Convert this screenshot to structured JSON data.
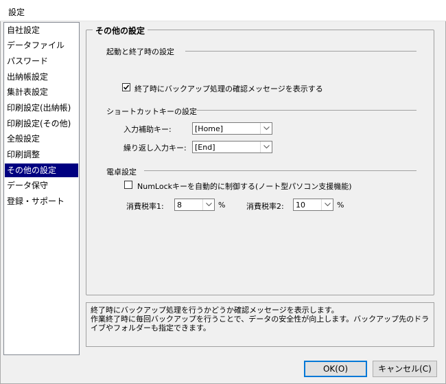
{
  "window": {
    "title": "設定"
  },
  "sidebar": {
    "items": [
      {
        "label": "自社設定"
      },
      {
        "label": "データファイル"
      },
      {
        "label": "パスワード"
      },
      {
        "label": "出納帳設定"
      },
      {
        "label": "集計表設定"
      },
      {
        "label": "印刷設定(出納帳)"
      },
      {
        "label": "印刷設定(その他)"
      },
      {
        "label": "全般設定"
      },
      {
        "label": "印刷調整"
      },
      {
        "label": "その他の設定"
      },
      {
        "label": "データ保守"
      },
      {
        "label": "登録・サポート"
      }
    ],
    "selected_label": "その他の設定"
  },
  "panel": {
    "title": "その他の設定",
    "startup": {
      "heading": "起動と終了時の設定",
      "backup_check_label": "終了時にバックアップ処理の確認メッセージを表示する",
      "backup_checked": true
    },
    "shortcut": {
      "heading": "ショートカットキーの設定",
      "input_assist_label": "入力補助キー:",
      "input_assist_value": "[Home]",
      "repeat_input_label": "繰り返し入力キー:",
      "repeat_input_value": "[End]"
    },
    "calculator": {
      "heading": "電卓設定",
      "numlock_label": "NumLockキーを自動的に制御する(ノート型パソコン支援機能)",
      "numlock_checked": false,
      "tax1_label": "消費税率1:",
      "tax1_value": "8",
      "tax1_unit": "%",
      "tax2_label": "消費税率2:",
      "tax2_value": "10",
      "tax2_unit": "%"
    }
  },
  "info": {
    "line1": "終了時にバックアップ処理を行うかどうか確認メッセージを表示します。",
    "line2": "作業終了時に毎回バックアップを行うことで、データの安全性が向上します。バックアップ先のドラ",
    "line3": "イブやフォルダーも指定できます。"
  },
  "buttons": {
    "ok": "OK(O)",
    "cancel": "キャンセル(C)"
  }
}
